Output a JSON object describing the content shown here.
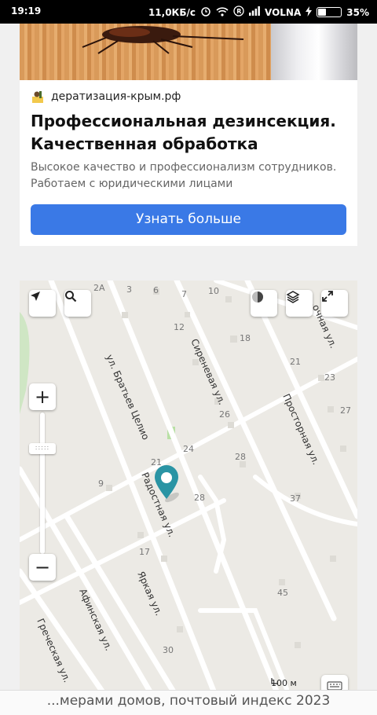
{
  "status_bar": {
    "time": "19:19",
    "network_speed": "11,0КБ/с",
    "carrier": "VOLNA",
    "battery": "35%",
    "battery_level": 0.35
  },
  "ad": {
    "domain": "дератизация-крым.рф",
    "title": "Профессиональная дезинсекция. Качественная обработка",
    "description": "Высокое качество и профессионализм сотрудников. Работаем с юридическими лицами",
    "button_label": "Узнать больше"
  },
  "map": {
    "streets": [
      "ул. Братьев Целио",
      "Сиреневая ул.",
      "Просторная ул.",
      "Радостная ул.",
      "Яркая ул.",
      "Афинская ул.",
      "Греческая ул.",
      "...очная ул."
    ],
    "house_numbers": [
      "2А",
      "3",
      "6",
      "7",
      "10",
      "12",
      "18",
      "21",
      "23",
      "26",
      "27",
      "24",
      "28",
      "21",
      "9",
      "28",
      "37",
      "17",
      "45",
      "30"
    ],
    "scale": "100 м",
    "zoom_in_label": "+",
    "zoom_out_label": "−",
    "zoom_handle_label": ":::::"
  },
  "bottom_bar": {
    "text": "...мерами домов, почтовый индекс 2023"
  },
  "colors": {
    "accent": "#3a79e6",
    "marker": "#2a94a4",
    "map_bg": "#eceae5"
  }
}
